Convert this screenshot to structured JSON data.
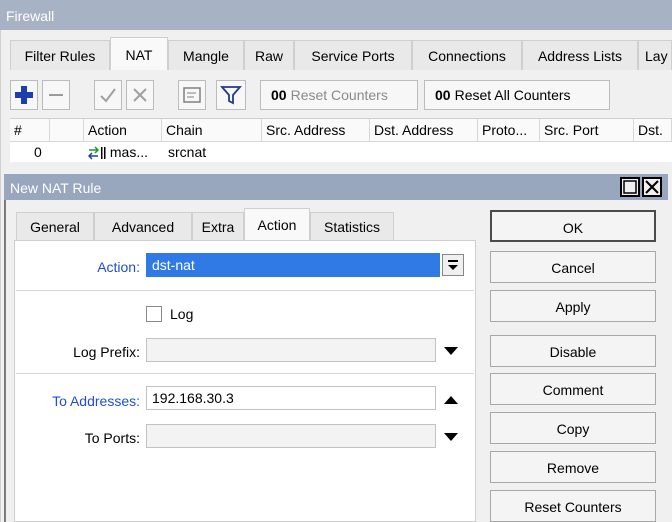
{
  "firewall": {
    "title": "Firewall",
    "tabs": [
      "Filter Rules",
      "NAT",
      "Mangle",
      "Raw",
      "Service Ports",
      "Connections",
      "Address Lists",
      "Lay"
    ],
    "toolbar": {
      "add_icon": "plus-icon",
      "remove_icon": "minus-icon",
      "enable_icon": "check-icon",
      "disable_icon": "cross-icon",
      "comment_icon": "comment-icon",
      "filter_icon": "filter-icon",
      "reset_counters_prefix": "00",
      "reset_counters": "Reset Counters",
      "reset_all_counters_prefix": "00",
      "reset_all_counters": "Reset All Counters"
    },
    "columns": [
      "#",
      "",
      "Action",
      "Chain",
      "Src. Address",
      "Dst. Address",
      "Proto...",
      "Src. Port",
      "Dst."
    ],
    "rows": [
      {
        "num": "0",
        "action": "mas...",
        "chain": "srcnat"
      }
    ]
  },
  "dialog": {
    "title": "New NAT Rule",
    "tabs": [
      "General",
      "Advanced",
      "Extra",
      "Action",
      "Statistics"
    ],
    "active_tab": "Action",
    "action_label": "Action:",
    "action_value": "dst-nat",
    "log_label": "Log",
    "log_prefix_label": "Log Prefix:",
    "log_prefix_value": "",
    "to_addresses_label": "To Addresses:",
    "to_addresses_value": "192.168.30.3",
    "to_ports_label": "To Ports:",
    "to_ports_value": "",
    "buttons": [
      "OK",
      "Cancel",
      "Apply",
      "Disable",
      "Comment",
      "Copy",
      "Remove",
      "Reset Counters"
    ]
  },
  "colors": {
    "selection": "#2f7ae5",
    "title_bar": "#98a6be",
    "label_blue": "#1f4fcf"
  }
}
